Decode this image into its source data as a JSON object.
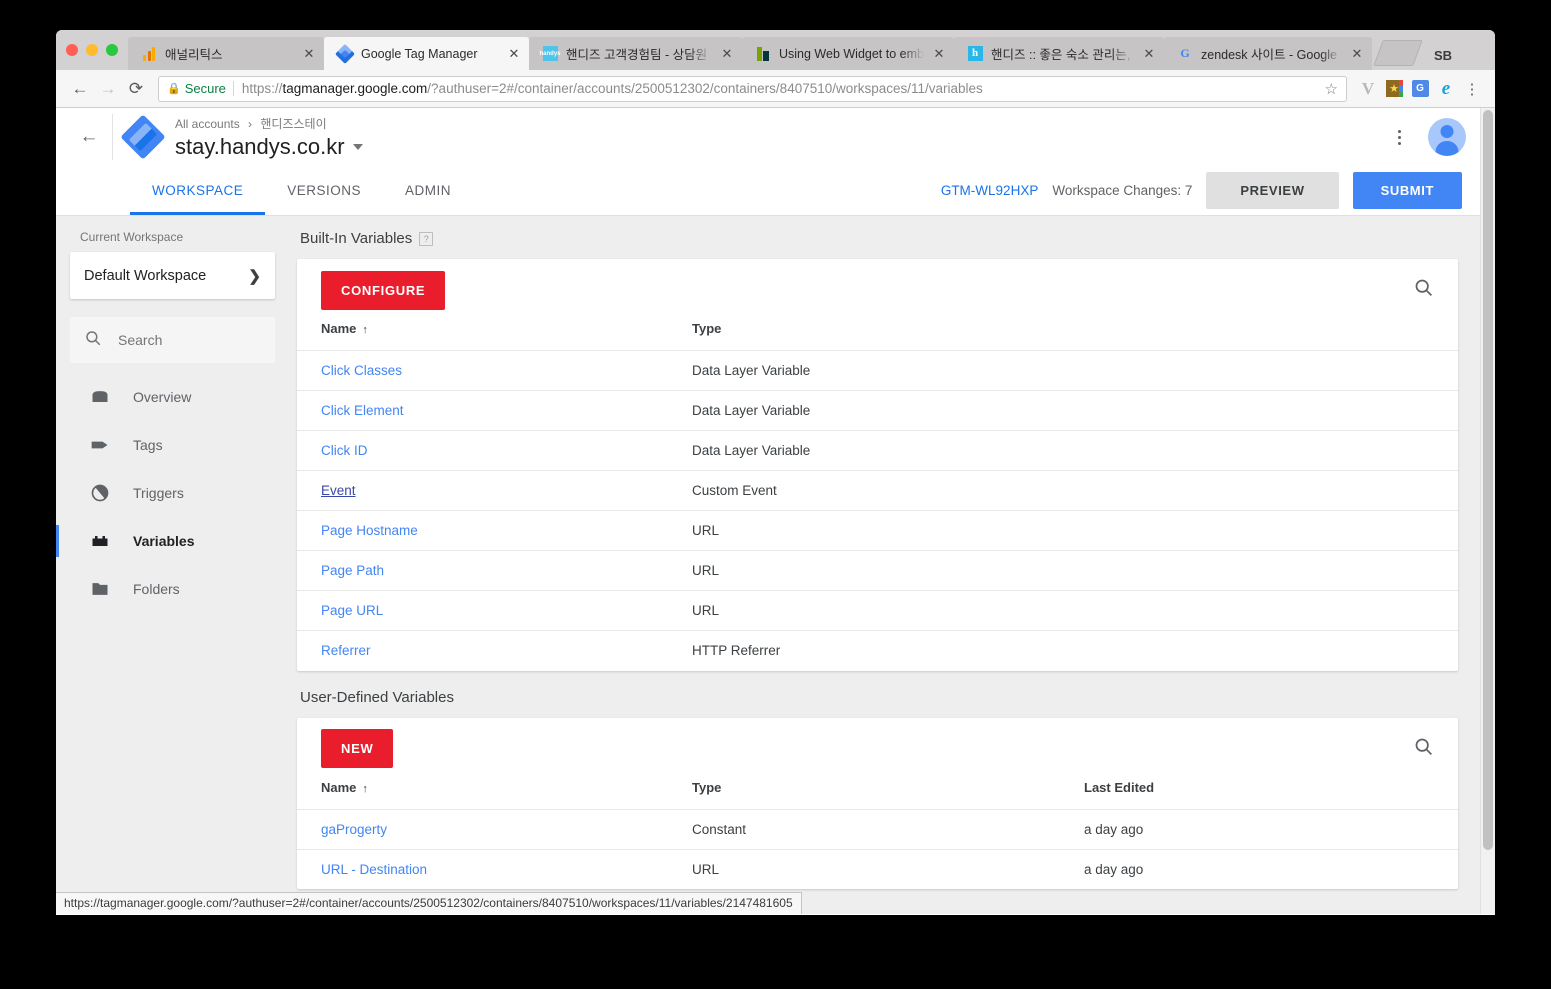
{
  "browser": {
    "profile_name": "SB",
    "tabs": [
      {
        "title": "애널리틱스",
        "favicon": "google-analytics-icon",
        "active": false,
        "close": "✕"
      },
      {
        "title": "Google Tag Manager",
        "favicon": "google-tag-manager-icon",
        "active": true,
        "close": "✕"
      },
      {
        "title": "핸디즈 고객경험팀 - 상담원",
        "favicon": "handys-icon",
        "active": false,
        "close": "✕"
      },
      {
        "title": "Using Web Widget to embed",
        "favicon": "zendesk-icon",
        "active": false,
        "close": "✕"
      },
      {
        "title": "핸디즈 :: 좋은 숙소 관리는, 핸디즈",
        "favicon": "handys-h-icon",
        "active": false,
        "close": "✕"
      },
      {
        "title": "zendesk 사이트 - Google 검색",
        "favicon": "google-icon",
        "active": false,
        "close": "✕"
      }
    ],
    "toolbar": {
      "back": "←",
      "forward": "→",
      "reload": "⟳",
      "lock": "🔒",
      "secure_label": "Secure",
      "url_scheme": "https://",
      "url_host": "tagmanager.google.com",
      "url_path": "/?authuser=2#/container/accounts/2500512302/containers/8407510/workspaces/11/variables",
      "star": "☆",
      "extensions": [
        "vimium-icon",
        "bookmark-manager-icon",
        "google-translate-icon",
        "ie-tab-icon"
      ],
      "menu": "⋮"
    },
    "status_bar_url": "https://tagmanager.google.com/?authuser=2#/container/accounts/2500512302/containers/8407510/workspaces/11/variables/2147481605"
  },
  "header": {
    "back_arrow": "←",
    "breadcrumb_root": "All accounts",
    "breadcrumb_sep": "›",
    "breadcrumb_account": "핸디즈스테이",
    "container_name": "stay.handys.co.kr",
    "kebab": "⋮"
  },
  "nav": {
    "tabs": [
      {
        "label": "WORKSPACE",
        "active": true
      },
      {
        "label": "VERSIONS",
        "active": false
      },
      {
        "label": "ADMIN",
        "active": false
      }
    ],
    "gtm_id": "GTM-WL92HXP",
    "workspace_changes": "Workspace Changes: 7",
    "preview_label": "PREVIEW",
    "submit_label": "SUBMIT"
  },
  "sidebar": {
    "current_workspace_label": "Current Workspace",
    "workspace_name": "Default Workspace",
    "chevron": "❯",
    "search_placeholder": "Search",
    "items": [
      {
        "label": "Overview",
        "icon": "overview-icon",
        "active": false
      },
      {
        "label": "Tags",
        "icon": "tag-icon",
        "active": false
      },
      {
        "label": "Triggers",
        "icon": "trigger-icon",
        "active": false
      },
      {
        "label": "Variables",
        "icon": "variables-icon",
        "active": true
      },
      {
        "label": "Folders",
        "icon": "folder-icon",
        "active": false
      }
    ]
  },
  "built_in": {
    "section_title": "Built-In Variables",
    "help_badge": "?",
    "configure_label": "CONFIGURE",
    "columns": {
      "name": "Name",
      "type": "Type"
    },
    "sort_arrow": "↑",
    "rows": [
      {
        "name": "Click Classes",
        "type": "Data Layer Variable",
        "hovered": false
      },
      {
        "name": "Click Element",
        "type": "Data Layer Variable",
        "hovered": false
      },
      {
        "name": "Click ID",
        "type": "Data Layer Variable",
        "hovered": false
      },
      {
        "name": "Event",
        "type": "Custom Event",
        "hovered": true
      },
      {
        "name": "Page Hostname",
        "type": "URL",
        "hovered": false
      },
      {
        "name": "Page Path",
        "type": "URL",
        "hovered": false
      },
      {
        "name": "Page URL",
        "type": "URL",
        "hovered": false
      },
      {
        "name": "Referrer",
        "type": "HTTP Referrer",
        "hovered": false
      }
    ]
  },
  "user_defined": {
    "section_title": "User-Defined Variables",
    "new_label": "NEW",
    "columns": {
      "name": "Name",
      "type": "Type",
      "edited": "Last Edited"
    },
    "sort_arrow": "↑",
    "rows": [
      {
        "name": "gaProgerty",
        "type": "Constant",
        "edited": "a day ago"
      },
      {
        "name": "URL - Destination",
        "type": "URL",
        "edited": "a day ago"
      }
    ]
  }
}
